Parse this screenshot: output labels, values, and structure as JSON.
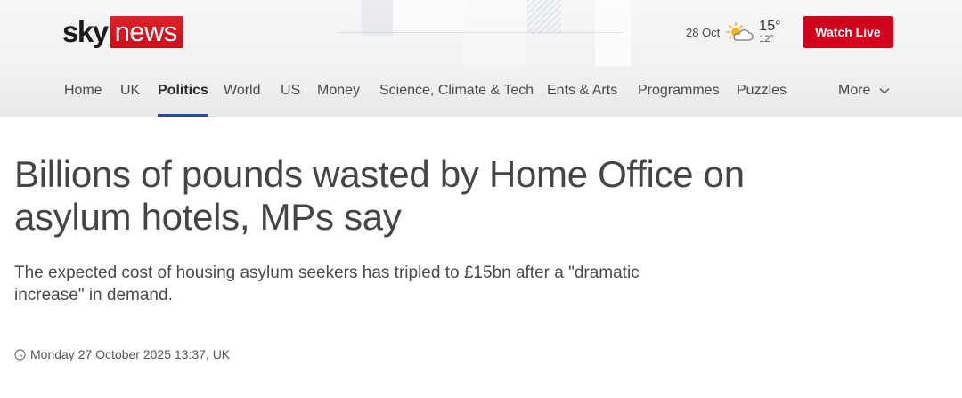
{
  "brand": {
    "sky": "sky",
    "news": "news",
    "accent": "#d0021b"
  },
  "weather": {
    "date": "28 Oct",
    "high": "15°",
    "low": "12°",
    "icon": "sun-cloud-icon"
  },
  "header": {
    "watch_live_label": "Watch Live"
  },
  "nav": {
    "items": [
      {
        "label": "Home"
      },
      {
        "label": "UK"
      },
      {
        "label": "Politics",
        "active": true
      },
      {
        "label": "World"
      },
      {
        "label": "US"
      },
      {
        "label": "Money"
      },
      {
        "label": "Science, Climate & Tech"
      },
      {
        "label": "Ents & Arts"
      },
      {
        "label": "Programmes"
      },
      {
        "label": "Puzzles"
      }
    ],
    "more_label": "More",
    "active_color": "#2a4c8c"
  },
  "article": {
    "headline": "Billions of pounds wasted by Home Office on asylum hotels, MPs say",
    "standfirst": "The expected cost of housing asylum seekers has tripled to £15bn after a \"dramatic increase\" in demand.",
    "timestamp": "Monday 27 October 2025 13:37, UK"
  }
}
